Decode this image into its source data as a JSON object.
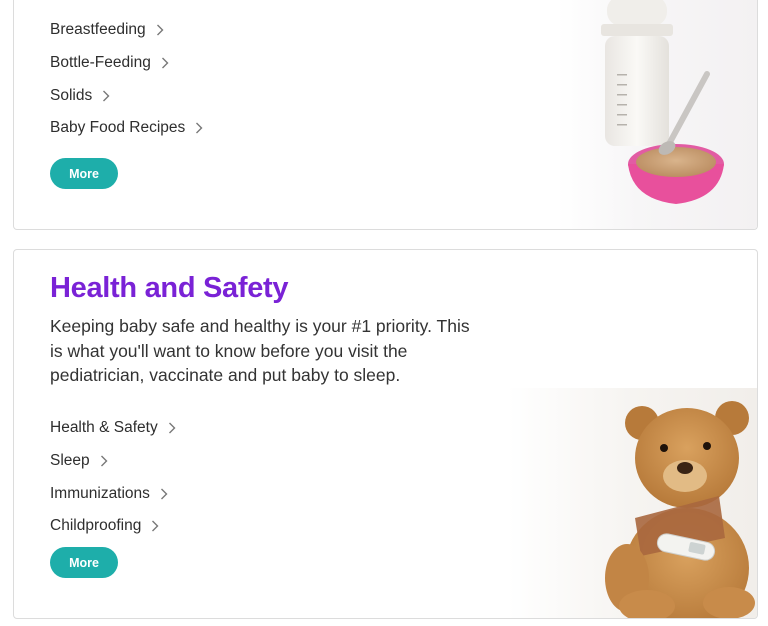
{
  "nutrition_card": {
    "links": [
      {
        "label": "Breastfeeding"
      },
      {
        "label": "Bottle-Feeding"
      },
      {
        "label": "Solids"
      },
      {
        "label": "Baby Food Recipes"
      }
    ],
    "more_label": "More",
    "image_icon": "baby-bottle-and-food-bowl"
  },
  "health_card": {
    "title": "Health and Safety",
    "description": "Keeping baby safe and healthy is your #1 priority. This is what you'll want to know before you visit the pediatrician, vaccinate and put baby to sleep.",
    "links": [
      {
        "label": "Health & Safety"
      },
      {
        "label": "Sleep"
      },
      {
        "label": "Immunizations"
      },
      {
        "label": "Childproofing"
      }
    ],
    "more_label": "More",
    "image_icon": "teddy-bear-with-thermometer"
  },
  "colors": {
    "accent": "#1eaeaa",
    "title": "#7a22d6",
    "text": "#2e2e2e",
    "border": "#dcdcdc"
  }
}
